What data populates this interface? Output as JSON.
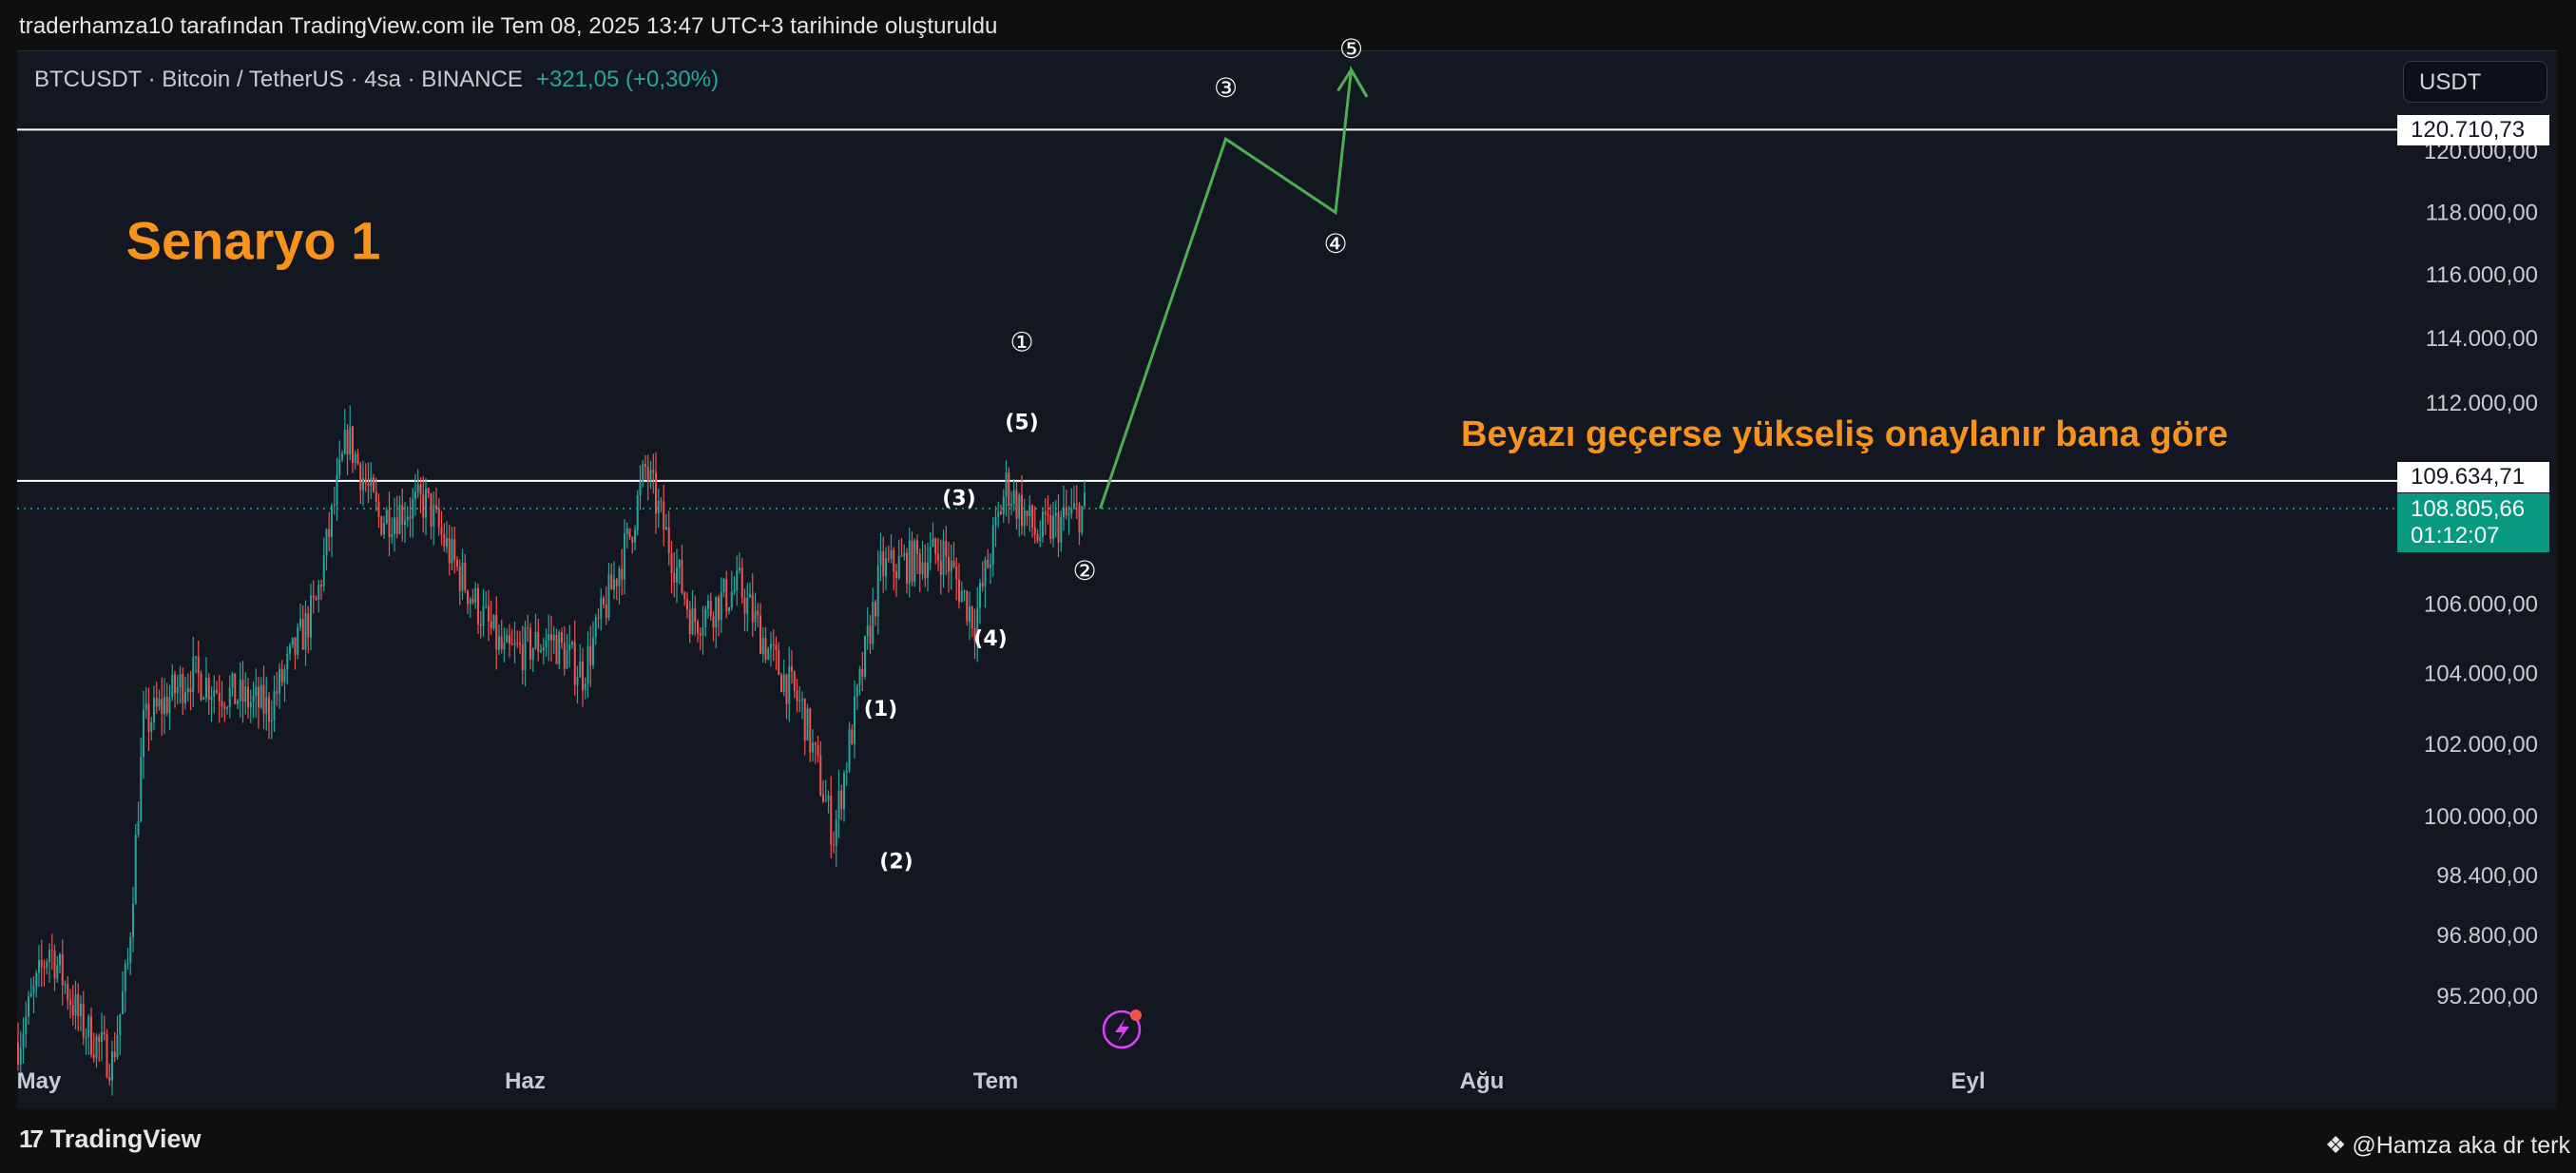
{
  "caption": "traderhamza10 tarafından TradingView.com ile Tem 08, 2025 13:47 UTC+3 tarihinde oluşturuldu",
  "symbol": {
    "ticker": "BTCUSDT",
    "name": "Bitcoin / TetherUS",
    "interval": "4sa",
    "exchange": "BINANCE",
    "change": "+321,05 (+0,30%)"
  },
  "currency_button": "USDT",
  "price_tags": {
    "upper_line": "120.710,73",
    "lower_line": "109.634,71",
    "current_price": "108.805,66",
    "countdown": "01:12:07"
  },
  "footer": {
    "brand": "TradingView",
    "author": "@Hamza aka dr terk"
  },
  "colors": {
    "background": "#131722",
    "up": "#26a69a",
    "down": "#ef5350",
    "annotation": "#f7931a",
    "projection": "#4caf50",
    "level_line": "#ffffff"
  },
  "chart_data": {
    "type": "candlestick",
    "title": "",
    "y_axis_ticks": [
      "120.000,00",
      "118.000,00",
      "116.000,00",
      "114.000,00",
      "112.000,00",
      "106.000,00",
      "104.000,00",
      "102.000,00",
      "100.000,00",
      "98.400,00",
      "96.800,00",
      "95.200,00"
    ],
    "y_tick_values": [
      120000,
      118000,
      116000,
      114000,
      112000,
      106000,
      104000,
      102000,
      100000,
      98400,
      96800,
      95200
    ],
    "scale": "log",
    "x_axis_ticks": [
      "May",
      "Haz",
      "Tem",
      "Ağu",
      "Eyl"
    ],
    "horizontal_levels": [
      120710.73,
      109634.71
    ],
    "current_price": 108805.66,
    "close_path": [
      {
        "date": "2025-05-01",
        "price": 94000
      },
      {
        "date": "2025-05-03",
        "price": 96500
      },
      {
        "date": "2025-05-05",
        "price": 94500
      },
      {
        "date": "2025-05-07",
        "price": 93500
      },
      {
        "date": "2025-05-08",
        "price": 96000
      },
      {
        "date": "2025-05-09",
        "price": 102500
      },
      {
        "date": "2025-05-12",
        "price": 104000
      },
      {
        "date": "2025-05-14",
        "price": 103500
      },
      {
        "date": "2025-05-17",
        "price": 103000
      },
      {
        "date": "2025-05-20",
        "price": 106000
      },
      {
        "date": "2025-05-22",
        "price": 111000
      },
      {
        "date": "2025-05-24",
        "price": 108500
      },
      {
        "date": "2025-05-27",
        "price": 109000
      },
      {
        "date": "2025-05-29",
        "price": 107000
      },
      {
        "date": "2025-06-01",
        "price": 104500
      },
      {
        "date": "2025-06-04",
        "price": 105000
      },
      {
        "date": "2025-06-06",
        "price": 104000
      },
      {
        "date": "2025-06-09",
        "price": 108000
      },
      {
        "date": "2025-06-10",
        "price": 110000
      },
      {
        "date": "2025-06-13",
        "price": 105500
      },
      {
        "date": "2025-06-16",
        "price": 106500
      },
      {
        "date": "2025-06-18",
        "price": 104500
      },
      {
        "date": "2025-06-20",
        "price": 103000
      },
      {
        "date": "2025-06-22",
        "price": 99500
      },
      {
        "date": "2025-06-23",
        "price": 102000
      },
      {
        "date": "2025-06-25",
        "price": 107000
      },
      {
        "date": "2025-06-29",
        "price": 107500
      },
      {
        "date": "2025-07-01",
        "price": 105500
      },
      {
        "date": "2025-07-03",
        "price": 109500
      },
      {
        "date": "2025-07-05",
        "price": 108000
      },
      {
        "date": "2025-07-08",
        "price": 108805.66
      }
    ],
    "projection_path": [
      {
        "date": "2025-07-09",
        "price": 108805.66
      },
      {
        "date": "2025-07-17",
        "price": 120400
      },
      {
        "date": "2025-07-24",
        "price": 118000
      },
      {
        "date": "2025-07-25",
        "price": 122700
      },
      {
        "date": "2025-07-26",
        "price": 121800
      }
    ],
    "annotations": [
      {
        "text": "Senaryo 1",
        "date": "2025-05-16",
        "price": 116500,
        "kind": "title"
      },
      {
        "text": "Beyazı geçerse yükseliş onaylanır bana göre",
        "date": "2025-08-01",
        "price": 110700,
        "kind": "note"
      },
      {
        "text": "①",
        "date": "2025-07-04",
        "price": 113600,
        "kind": "wave"
      },
      {
        "text": "(5)",
        "date": "2025-07-04",
        "price": 111200,
        "kind": "wave"
      },
      {
        "text": "(3)",
        "date": "2025-06-30",
        "price": 108900,
        "kind": "wave"
      },
      {
        "text": "②",
        "date": "2025-07-08",
        "price": 106700,
        "kind": "wave"
      },
      {
        "text": "(4)",
        "date": "2025-07-02",
        "price": 104800,
        "kind": "wave"
      },
      {
        "text": "(1)",
        "date": "2025-06-25",
        "price": 102800,
        "kind": "wave"
      },
      {
        "text": "(2)",
        "date": "2025-06-26",
        "price": 98600,
        "kind": "wave"
      },
      {
        "text": "③",
        "date": "2025-07-17",
        "price": 121800,
        "kind": "wave"
      },
      {
        "text": "④",
        "date": "2025-07-24",
        "price": 116700,
        "kind": "wave"
      },
      {
        "text": "⑤",
        "date": "2025-07-25",
        "price": 123100,
        "kind": "wave"
      }
    ]
  }
}
